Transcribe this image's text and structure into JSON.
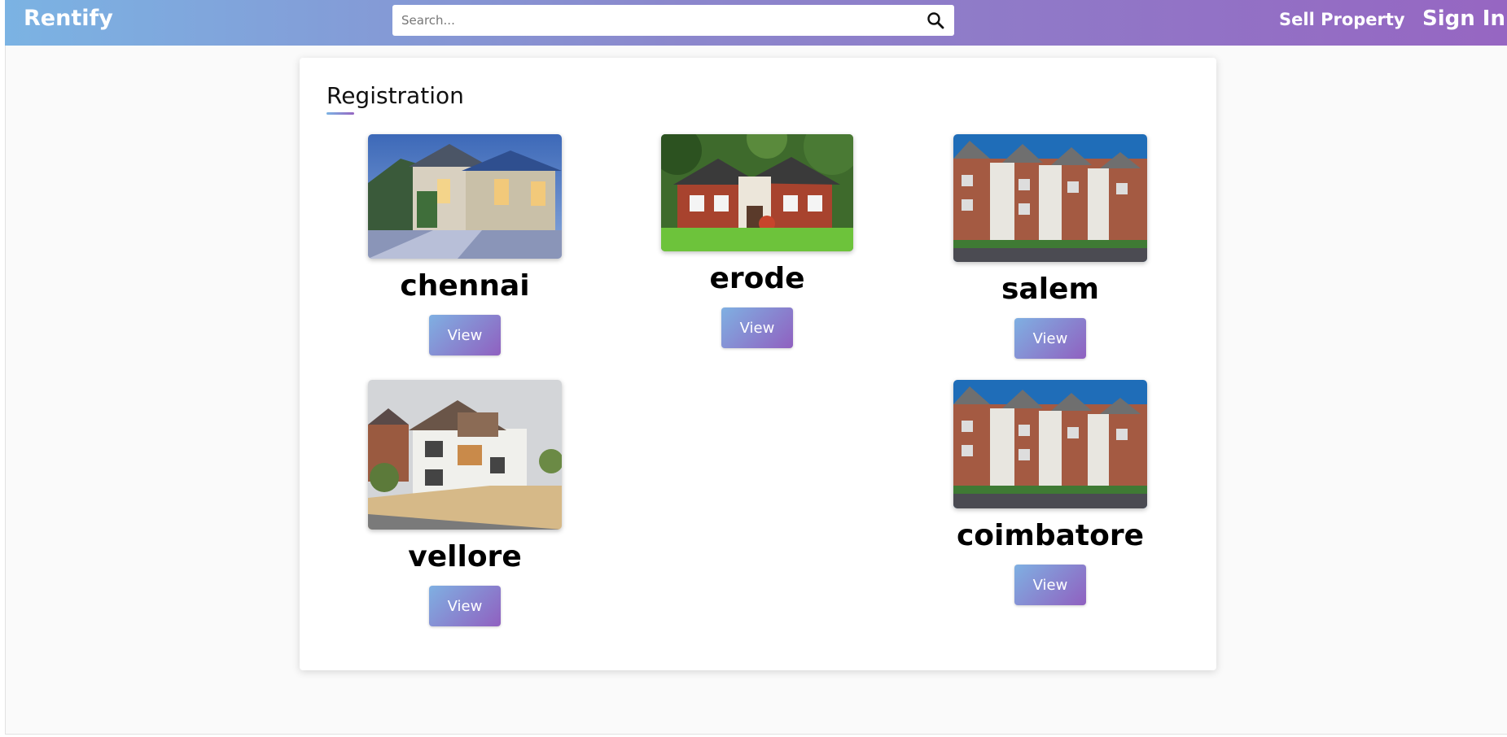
{
  "app": {
    "brand": "Rentify"
  },
  "search": {
    "placeholder": "Search..."
  },
  "nav": {
    "sell_label": "Sell Property",
    "signin_label": "Sign In"
  },
  "page": {
    "title": "Registration"
  },
  "listings": [
    {
      "city": "chennai",
      "button": "View",
      "image": "luxury-house-photo"
    },
    {
      "city": "erode",
      "button": "View",
      "image": "brick-house-photo"
    },
    {
      "city": "salem",
      "button": "View",
      "image": "apartment-building-photo"
    },
    {
      "city": "vellore",
      "button": "View",
      "image": "white-house-photo"
    },
    {
      "city": "coimbatore",
      "button": "View",
      "image": "apartment-building-photo"
    }
  ],
  "colors": {
    "accent_start": "#7bb3e3",
    "accent_end": "#9666c2"
  },
  "icons": {
    "search": "search-icon"
  }
}
